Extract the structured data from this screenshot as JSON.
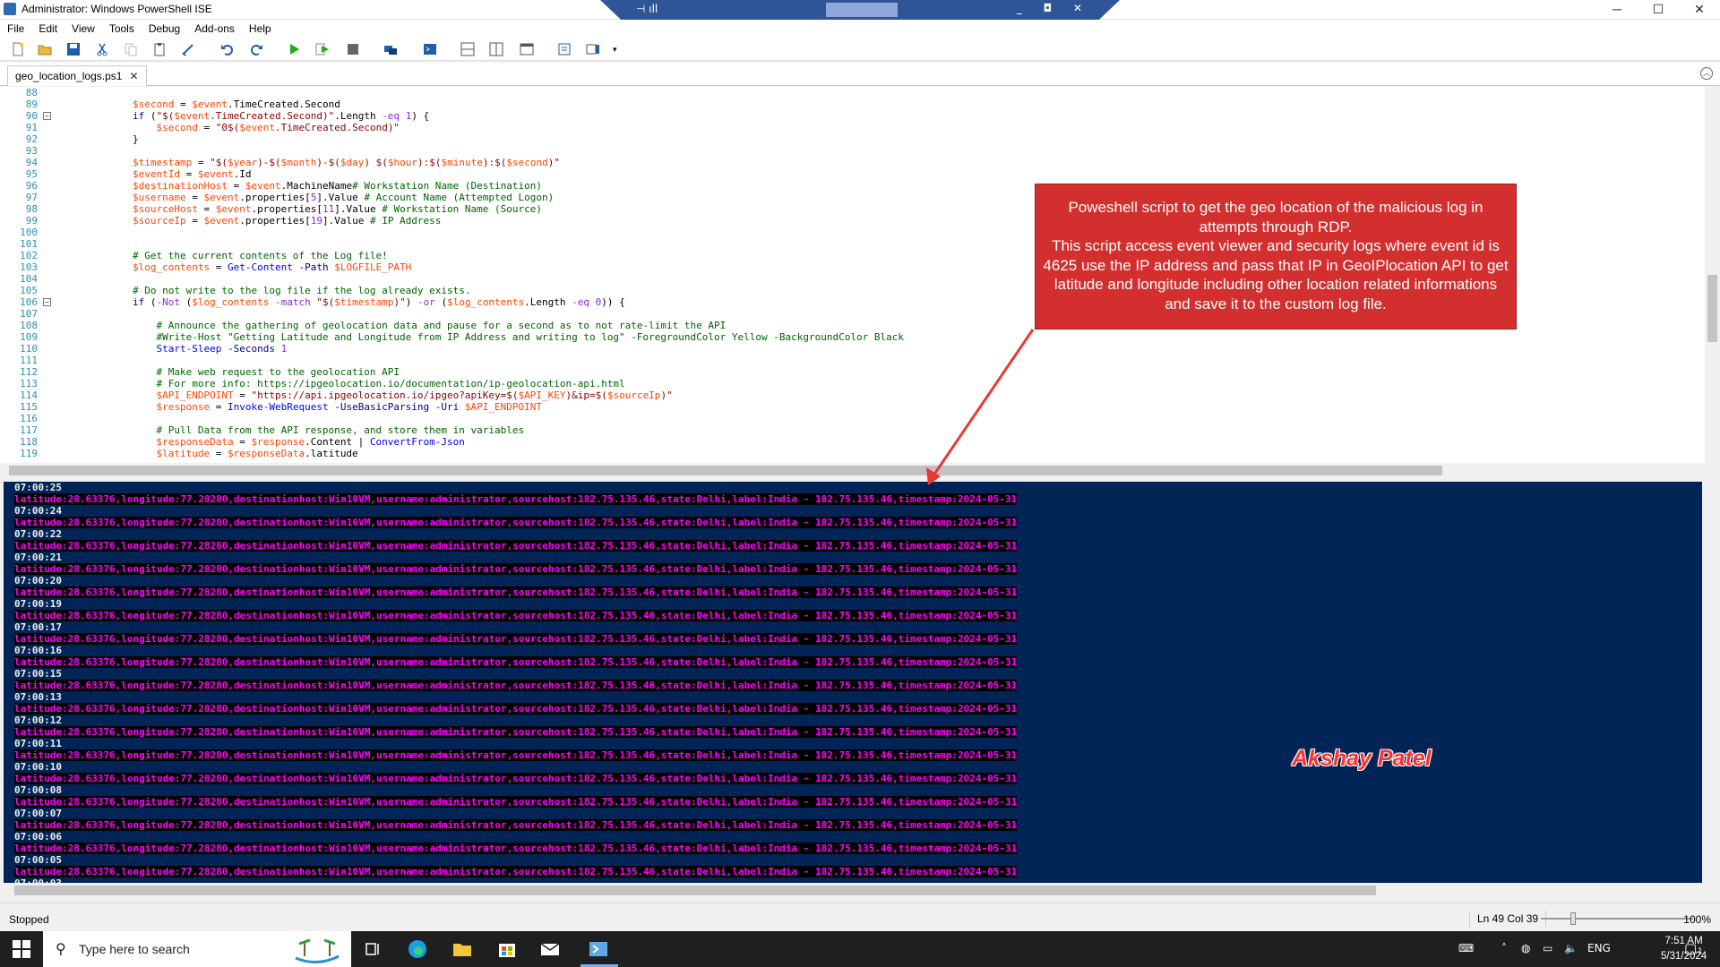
{
  "window": {
    "title": "Administrator: Windows PowerShell ISE",
    "minimize": "─",
    "maximize": "☐",
    "close": "✕"
  },
  "rdp": {
    "pin": "⊣ ıll",
    "controls": "_ ◘ ✕"
  },
  "menu": [
    "File",
    "Edit",
    "View",
    "Tools",
    "Debug",
    "Add-ons",
    "Help"
  ],
  "toolbar_icons": [
    "new-icon",
    "open-icon",
    "save-icon",
    "cut-icon",
    "copy-icon",
    "paste-icon",
    "clear-icon",
    "undo-icon",
    "redo-icon",
    "run-icon",
    "run-selection-icon",
    "stop-icon",
    "remote-icon",
    "console-icon",
    "layout-top-icon",
    "layout-right-icon",
    "layout-max-icon",
    "commands-icon",
    "addon-icon"
  ],
  "tab": {
    "label": "geo_location_logs.ps1",
    "close": "✕"
  },
  "editor": {
    "line_numbers": [
      "88",
      "89",
      "90",
      "91",
      "92",
      "93",
      "94",
      "95",
      "96",
      "97",
      "98",
      "99",
      "100",
      "101",
      "102",
      "103",
      "104",
      "105",
      "106",
      "107",
      "108",
      "109",
      "110",
      "111",
      "112",
      "113",
      "114",
      "115",
      "116",
      "117",
      "118",
      "119"
    ]
  },
  "callout": {
    "text": "Poweshell script to get the geo location of the malicious log in attempts through RDP.\n This script access event viewer and security logs where event id is 4625 use the IP address and pass that IP in GeoIPlocation API to get latitude and longitude including other location related informations and save it to the custom log file."
  },
  "signature": "Akshay Patel",
  "console": {
    "first_line": "07:00:25",
    "rows": [
      {
        "ts": "07:00:24"
      },
      {
        "ts": "07:00:22"
      },
      {
        "ts": "07:00:21"
      },
      {
        "ts": "07:00:20"
      },
      {
        "ts": "07:00:19"
      },
      {
        "ts": "07:00:17"
      },
      {
        "ts": "07:00:16"
      },
      {
        "ts": "07:00:15"
      },
      {
        "ts": "07:00:13"
      },
      {
        "ts": "07:00:12"
      },
      {
        "ts": "07:00:11"
      },
      {
        "ts": "07:00:10"
      },
      {
        "ts": "07:00:08"
      },
      {
        "ts": "07:00:07"
      },
      {
        "ts": "07:00:06"
      },
      {
        "ts": "07:00:05"
      },
      {
        "ts": "07:00:03"
      }
    ],
    "log_line": "latitude:28.63376,longitude:77.28280,destinationhost:Win10VM,username:administrator,sourcehost:182.75.135.46,state:Delhi,label:India - 182.75.135.46,timestamp:2024-05-31"
  },
  "status": {
    "state": "Stopped",
    "position": "Ln 49  Col 39",
    "zoom": "100%",
    "zoom_level": 0.2
  },
  "taskbar": {
    "search_placeholder": "Type here to search",
    "language": "ENG",
    "time": "7:51 AM",
    "date": "5/31/2024",
    "notification_count": "1"
  },
  "colors": {
    "console_bg": "#012456",
    "log_fg": "#ff00ff",
    "callout_bg": "#d32f2f",
    "accent": "#2f5597"
  }
}
